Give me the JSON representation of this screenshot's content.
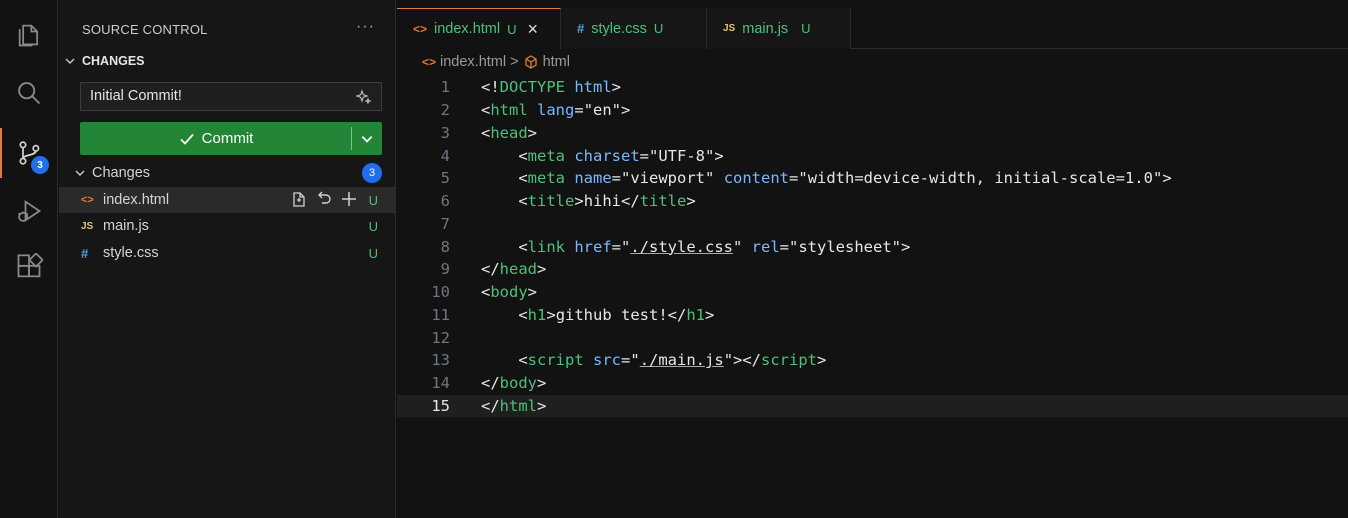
{
  "activity_bar": {
    "items": [
      {
        "name": "explorer-icon"
      },
      {
        "name": "search-icon"
      },
      {
        "name": "source-control-icon",
        "badge": "3"
      },
      {
        "name": "run-debug-icon"
      },
      {
        "name": "extensions-icon"
      }
    ]
  },
  "sidebar": {
    "title": "SOURCE CONTROL",
    "more": "···",
    "section_title": "CHANGES",
    "commit_message": "Initial Commit!",
    "commit_label": "Commit",
    "changes_label": "Changes",
    "changes_count": "3",
    "files": [
      {
        "icon": "<>",
        "name": "index.html",
        "status": "U",
        "icon_color": "#e07b39"
      },
      {
        "icon": "JS",
        "name": "main.js",
        "status": "U",
        "icon_color": "#e5c07b"
      },
      {
        "icon": "#",
        "name": "style.css",
        "status": "U",
        "icon_color": "#4fa3e0"
      }
    ]
  },
  "editor": {
    "tabs": [
      {
        "icon": "<>",
        "label": "index.html",
        "status": "U",
        "close": "×"
      },
      {
        "icon": "#",
        "label": "style.css",
        "status": "U"
      },
      {
        "icon": "JS",
        "label": "main.js",
        "status": "U"
      }
    ],
    "breadcrumb": {
      "file": "index.html",
      "separator": ">",
      "symbol": "html"
    },
    "current_line": 15
  },
  "code_lines": [
    {
      "n": "1"
    },
    {
      "n": "2"
    },
    {
      "n": "3"
    },
    {
      "n": "4"
    },
    {
      "n": "5"
    },
    {
      "n": "6"
    },
    {
      "n": "7"
    },
    {
      "n": "8"
    },
    {
      "n": "9"
    },
    {
      "n": "10"
    },
    {
      "n": "11"
    },
    {
      "n": "12"
    },
    {
      "n": "13"
    },
    {
      "n": "14"
    },
    {
      "n": "15"
    }
  ],
  "code_text": {
    "doctype_open": "<!",
    "doctype": "DOCTYPE",
    "doctype_html": "html",
    "l2_attr": "lang",
    "l2_val": "\"en\"",
    "l4_attr": "charset",
    "l4_val": "\"UTF-8\"",
    "l5_attr1": "name",
    "l5_val1": "\"viewport\"",
    "l5_attr2": "content",
    "l5_val2": "\"width=device-width, initial-scale=1.0\"",
    "l6_text": "hihi",
    "l8_attr1": "href",
    "l8_val1": "./style.css",
    "l8_attr2": "rel",
    "l8_val2": "\"stylesheet\"",
    "l11_text": "github test!",
    "l13_attr": "src",
    "l13_val": "./main.js"
  },
  "colors": {
    "tag": "#4ec07a",
    "attr": "#79b8ff",
    "accent": "#e07b39",
    "commit": "#238636",
    "badge": "#1f6feb"
  }
}
